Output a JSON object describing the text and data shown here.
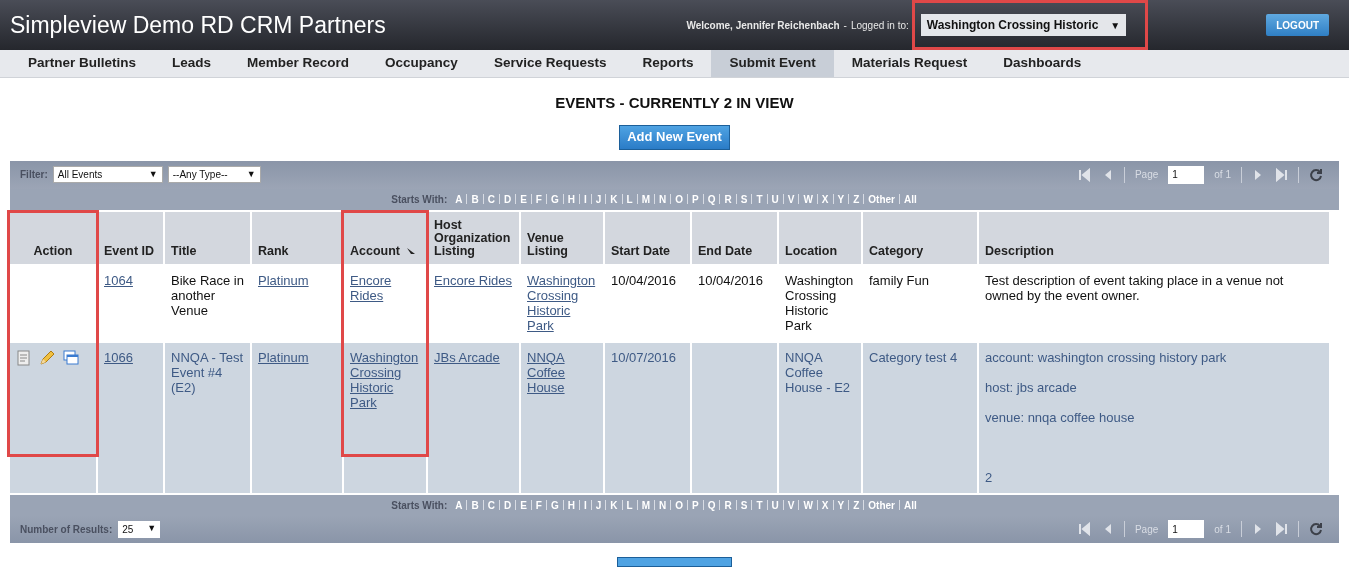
{
  "header": {
    "title": "Simpleview Demo RD CRM Partners",
    "welcome": "Welcome, Jennifer Reichenbach",
    "separator": "-",
    "logged_in_label": "Logged in to:",
    "account_select": "Washington Crossing Historic",
    "account_caret": "▼",
    "account_outlined": true,
    "logout": "LOGOUT"
  },
  "nav": [
    {
      "label": "Partner Bulletins",
      "selected": false
    },
    {
      "label": "Leads",
      "selected": false
    },
    {
      "label": "Member Record",
      "selected": false
    },
    {
      "label": "Occupancy",
      "selected": false
    },
    {
      "label": "Service Requests",
      "selected": false
    },
    {
      "label": "Reports",
      "selected": false
    },
    {
      "label": "Submit Event",
      "selected": true
    },
    {
      "label": "Materials Request",
      "selected": false
    },
    {
      "label": "Dashboards",
      "selected": false
    }
  ],
  "heading": "EVENTS - CURRENTLY 2 IN VIEW",
  "add_button": "Add New Event",
  "top_bar": {
    "filter_label": "Filter:",
    "filters": [
      {
        "value": "All Events",
        "caret": "▼"
      },
      {
        "value": "--Any Type--",
        "caret": "▼"
      }
    ],
    "pager": {
      "page_label": "Page",
      "page": "1",
      "of": "of 1"
    },
    "starts_with": {
      "label": "Starts With:",
      "letters": [
        "A",
        "B",
        "C",
        "D",
        "E",
        "F",
        "G",
        "H",
        "I",
        "J",
        "K",
        "L",
        "M",
        "N",
        "O",
        "P",
        "Q",
        "R",
        "S",
        "T",
        "U",
        "V",
        "W",
        "X",
        "Y",
        "Z",
        "Other",
        "All"
      ]
    }
  },
  "table": {
    "columns": [
      {
        "label": "Action",
        "sorted": false,
        "outlined": true
      },
      {
        "label": "Event ID",
        "sorted": false,
        "outlined": false
      },
      {
        "label": "Title",
        "sorted": false,
        "outlined": false
      },
      {
        "label": "Rank",
        "sorted": false,
        "outlined": false
      },
      {
        "label": "Account",
        "sorted": true,
        "outlined": true
      },
      {
        "label": "Host Organization Listing",
        "sorted": false,
        "outlined": false
      },
      {
        "label": "Venue Listing",
        "sorted": false,
        "outlined": false
      },
      {
        "label": "Start Date",
        "sorted": false,
        "outlined": false
      },
      {
        "label": "End Date",
        "sorted": false,
        "outlined": false
      },
      {
        "label": "Location",
        "sorted": false,
        "outlined": false
      },
      {
        "label": "Category",
        "sorted": false,
        "outlined": false
      },
      {
        "label": "Description",
        "sorted": false,
        "outlined": false
      }
    ],
    "rows": [
      {
        "highlighted": false,
        "has_actions": false,
        "event_id": "1064",
        "title": "Bike Race in another Venue",
        "rank": "Platinum",
        "account": "Encore Rides",
        "host": "Encore Rides",
        "venue": "Washington Crossing Historic Park",
        "start_date": "10/04/2016",
        "end_date": "10/04/2016",
        "location": "Washington Crossing Historic Park",
        "category": "family Fun",
        "description": [
          "Test description of event taking place in a venue not owned by the event owner."
        ]
      },
      {
        "highlighted": true,
        "has_actions": true,
        "event_id": "1066",
        "title": "NNQA - Test Event #4 (E2)",
        "rank": "Platinum",
        "account": "Washington Crossing Historic Park",
        "host": "JBs Arcade",
        "venue": "NNQA Coffee House",
        "start_date": "10/07/2016",
        "location": "NNQA Coffee House - E2",
        "category": "Category test 4",
        "description": [
          "account: washington crossing history park",
          "host: jbs arcade",
          "venue: nnqa coffee house"
        ],
        "description_note": "2"
      }
    ]
  },
  "bottom_bar": {
    "starts_with": {
      "label": "Starts With:",
      "letters": [
        "A",
        "B",
        "C",
        "D",
        "E",
        "F",
        "G",
        "H",
        "I",
        "J",
        "K",
        "L",
        "M",
        "N",
        "O",
        "P",
        "Q",
        "R",
        "S",
        "T",
        "U",
        "V",
        "W",
        "X",
        "Y",
        "Z",
        "Other",
        "All"
      ]
    },
    "results_label": "Number of Results:",
    "results_select": "25",
    "results_caret": "▼",
    "pager": {
      "page_label": "Page",
      "page": "1",
      "of": "of 1"
    }
  }
}
